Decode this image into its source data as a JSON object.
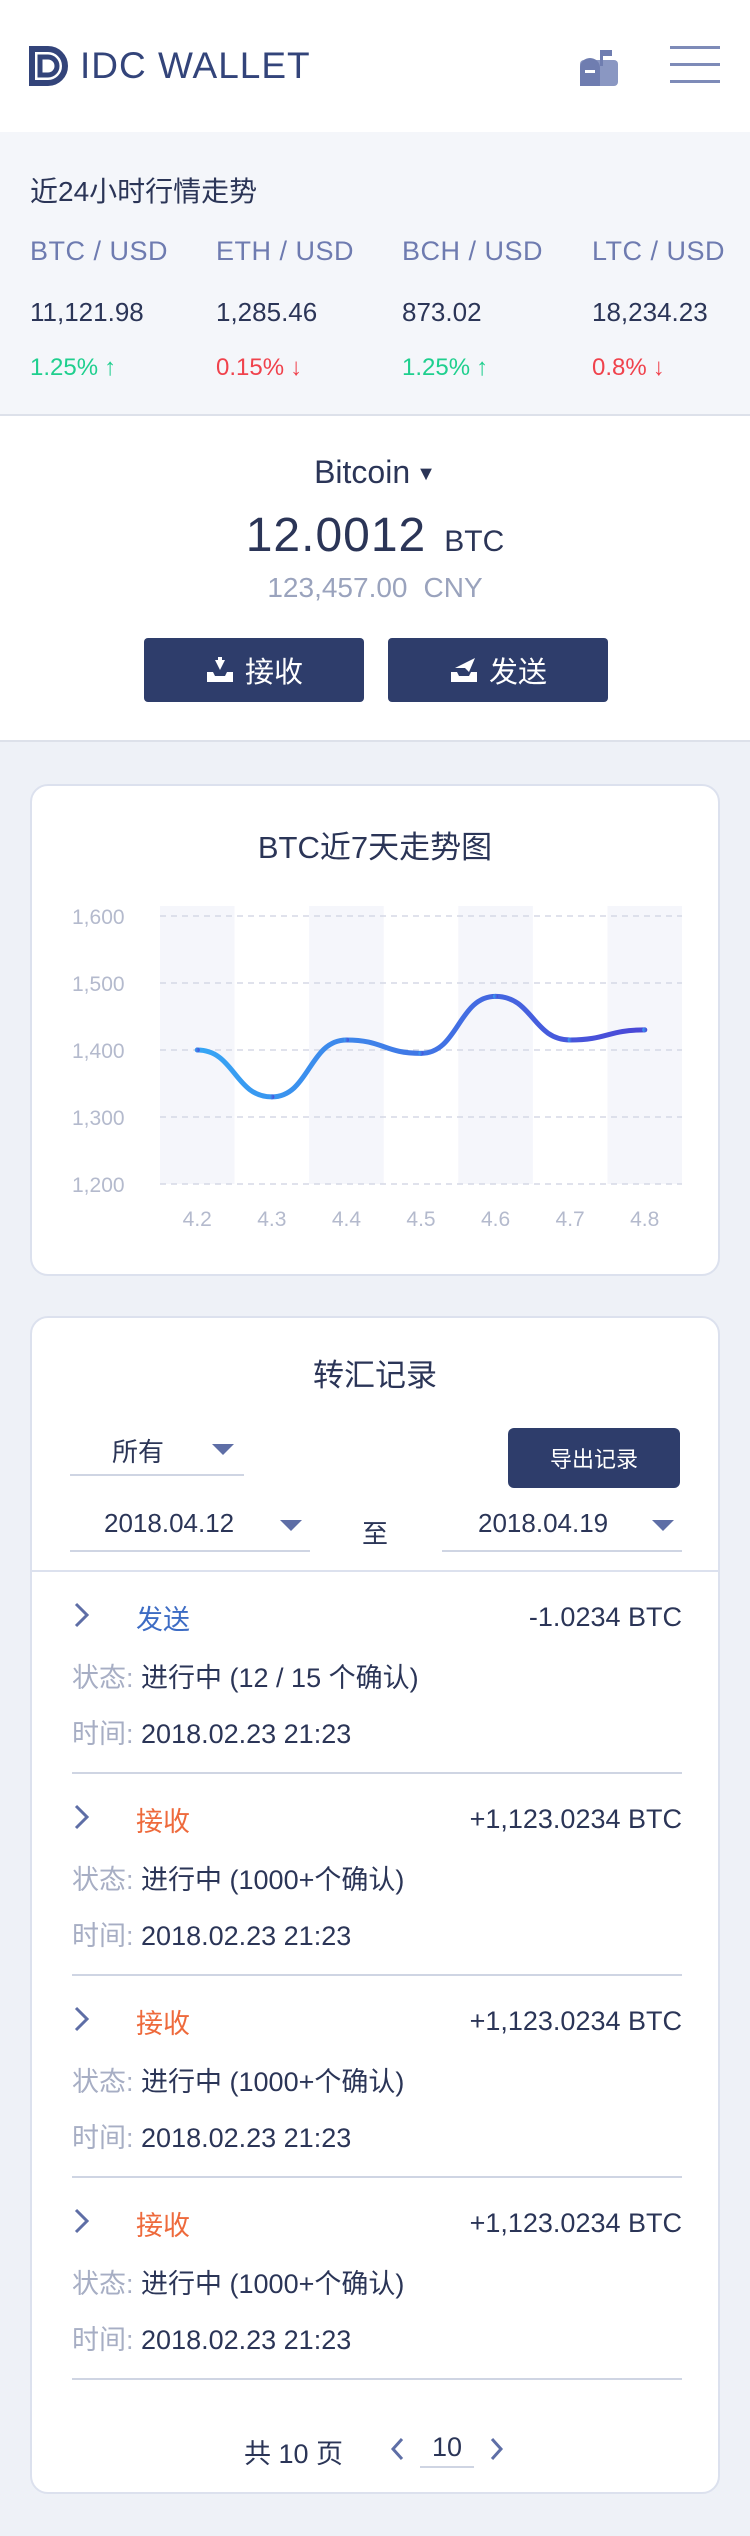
{
  "header": {
    "logo_text": "IDC WALLET",
    "icons": [
      "logo-mark-icon",
      "mailbox-icon",
      "menu-icon"
    ]
  },
  "market": {
    "title": "近24小时行情走势",
    "items": [
      {
        "pair": "BTC / USD",
        "price": "11,121.98",
        "change": "1.25%",
        "direction": "up"
      },
      {
        "pair": "ETH / USD",
        "price": "1,285.46",
        "change": "0.15%",
        "direction": "down"
      },
      {
        "pair": "BCH / USD",
        "price": "873.02",
        "change": "1.25%",
        "direction": "up"
      },
      {
        "pair": "LTC / USD",
        "price": "18,234.23",
        "change": "0.8%",
        "direction": "down"
      }
    ]
  },
  "balance": {
    "coin": "Bitcoin",
    "amount": "12.0012",
    "amount_unit": "BTC",
    "cny_amount": "123,457.00",
    "cny_unit": "CNY",
    "receive_label": "接收",
    "send_label": "发送"
  },
  "chart_card": {
    "title": "BTC近7天走势图"
  },
  "chart_data": {
    "type": "line",
    "title": "BTC近7天走势图",
    "categories": [
      "4.2",
      "4.3",
      "4.4",
      "4.5",
      "4.6",
      "4.7",
      "4.8"
    ],
    "y_ticks": [
      "1,200",
      "1,300",
      "1,400",
      "1,500",
      "1,600"
    ],
    "ylim": [
      1200,
      1600
    ],
    "values": [
      1400,
      1330,
      1415,
      1395,
      1480,
      1415,
      1430
    ],
    "grid": "dashed horizontal",
    "colors": {
      "line_start": "#36a6f5",
      "line_end": "#4b47d6",
      "band": "#f5f6fb"
    }
  },
  "records": {
    "title": "转汇记录",
    "filter_type": "所有",
    "export_label": "导出记录",
    "date_from": "2018.04.12",
    "to_label": "至",
    "date_to": "2018.04.19",
    "status_label": "状态:",
    "time_label": "时间:",
    "items": [
      {
        "type": "发送",
        "kind": "send",
        "amount": "-1.0234 BTC",
        "status": "进行中 (12 / 15 个确认)",
        "time": "2018.02.23 21:23"
      },
      {
        "type": "接收",
        "kind": "recv",
        "amount": "+1,123.0234 BTC",
        "status": "进行中 (1000+个确认)",
        "time": "2018.02.23 21:23"
      },
      {
        "type": "接收",
        "kind": "recv",
        "amount": "+1,123.0234 BTC",
        "status": "进行中 (1000+个确认)",
        "time": "2018.02.23 21:23"
      },
      {
        "type": "接收",
        "kind": "recv",
        "amount": "+1,123.0234 BTC",
        "status": "进行中 (1000+个确认)",
        "time": "2018.02.23 21:23"
      }
    ],
    "pager": {
      "total_text": "共 10 页",
      "current_page": "10"
    }
  }
}
